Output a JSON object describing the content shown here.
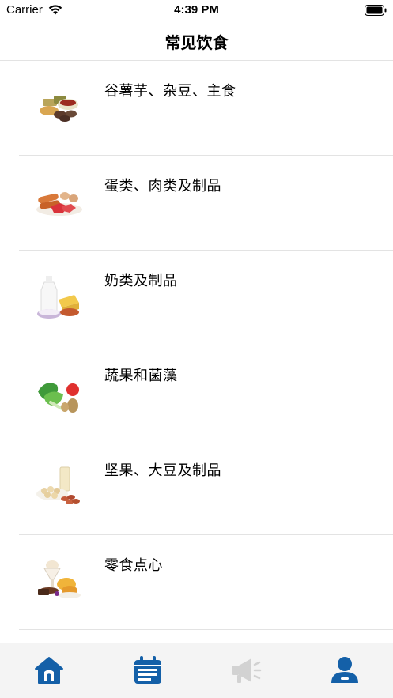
{
  "status_bar": {
    "carrier": "Carrier",
    "time": "4:39 PM"
  },
  "nav": {
    "title": "常见饮食"
  },
  "categories": [
    {
      "label": "谷薯芋、杂豆、主食",
      "icon": "grains-food-icon"
    },
    {
      "label": "蛋类、肉类及制品",
      "icon": "meat-eggs-icon"
    },
    {
      "label": "奶类及制品",
      "icon": "dairy-icon"
    },
    {
      "label": "蔬果和菌藻",
      "icon": "vegetables-fruit-icon"
    },
    {
      "label": "坚果、大豆及制品",
      "icon": "nuts-soy-icon"
    },
    {
      "label": "零食点心",
      "icon": "snacks-icon"
    }
  ],
  "tab_bar": {
    "items": [
      {
        "icon": "home-icon",
        "state": "active"
      },
      {
        "icon": "calendar-icon",
        "state": "active"
      },
      {
        "icon": "megaphone-icon",
        "state": "disabled"
      },
      {
        "icon": "profile-icon",
        "state": "active"
      }
    ]
  },
  "colors": {
    "tab_active": "#1460a8",
    "tab_disabled": "#d2d2d2",
    "divider": "#e3e3e3",
    "tab_background": "#f4f4f4"
  }
}
